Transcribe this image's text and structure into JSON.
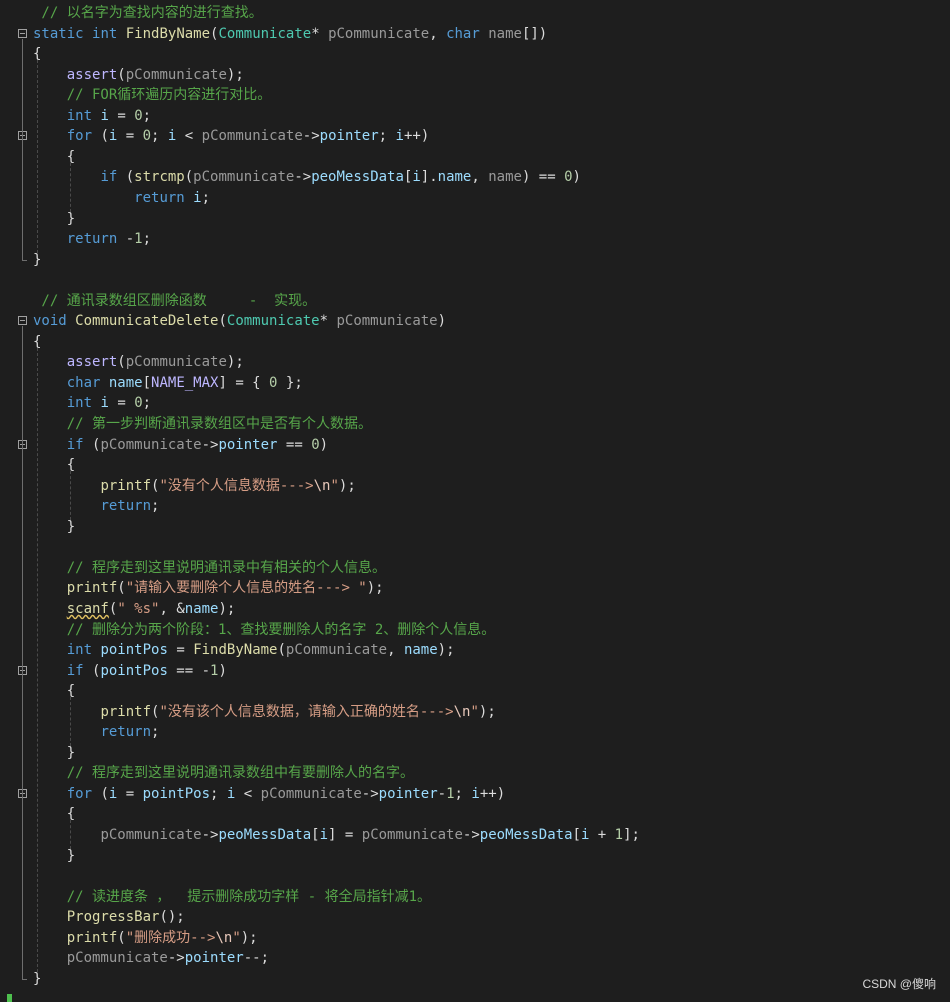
{
  "editor": {
    "lines": [
      [
        [
          "t-cmt",
          " // 以名字为查找内容的进行查找。"
        ]
      ],
      [
        [
          "t-kw",
          "static"
        ],
        [
          "t-pu",
          " "
        ],
        [
          "t-kw",
          "int"
        ],
        [
          "t-pu",
          " "
        ],
        [
          "t-fn",
          "FindByName"
        ],
        [
          "t-pu",
          "("
        ],
        [
          "t-ty",
          "Communicate"
        ],
        [
          "t-pu",
          "* "
        ],
        [
          "t-pa",
          "pCommunicate"
        ],
        [
          "t-pu",
          ", "
        ],
        [
          "t-kw",
          "char"
        ],
        [
          "t-pu",
          " "
        ],
        [
          "t-pa",
          "name"
        ],
        [
          "t-pu",
          "[])"
        ]
      ],
      [
        [
          "t-pu",
          "{"
        ]
      ],
      [
        [
          "t-pu",
          "    "
        ],
        [
          "t-mc",
          "assert"
        ],
        [
          "t-pu",
          "("
        ],
        [
          "t-pa",
          "pCommunicate"
        ],
        [
          "t-pu",
          ");"
        ]
      ],
      [
        [
          "t-pu",
          "    "
        ],
        [
          "t-cmt",
          "// FOR循环遍历内容进行对比。"
        ]
      ],
      [
        [
          "t-pu",
          "    "
        ],
        [
          "t-kw",
          "int"
        ],
        [
          "t-pu",
          " "
        ],
        [
          "t-lv",
          "i"
        ],
        [
          "t-pu",
          " = "
        ],
        [
          "t-nu",
          "0"
        ],
        [
          "t-pu",
          ";"
        ]
      ],
      [
        [
          "t-pu",
          "    "
        ],
        [
          "t-kw",
          "for"
        ],
        [
          "t-pu",
          " ("
        ],
        [
          "t-lv",
          "i"
        ],
        [
          "t-pu",
          " = "
        ],
        [
          "t-nu",
          "0"
        ],
        [
          "t-pu",
          "; "
        ],
        [
          "t-lv",
          "i"
        ],
        [
          "t-pu",
          " < "
        ],
        [
          "t-pa",
          "pCommunicate"
        ],
        [
          "t-pu",
          "->"
        ],
        [
          "t-lv",
          "pointer"
        ],
        [
          "t-pu",
          "; "
        ],
        [
          "t-lv",
          "i"
        ],
        [
          "t-pu",
          "++)"
        ]
      ],
      [
        [
          "t-pu",
          "    {"
        ]
      ],
      [
        [
          "t-pu",
          "        "
        ],
        [
          "t-kw",
          "if"
        ],
        [
          "t-pu",
          " ("
        ],
        [
          "t-fn",
          "strcmp"
        ],
        [
          "t-pu",
          "("
        ],
        [
          "t-pa",
          "pCommunicate"
        ],
        [
          "t-pu",
          "->"
        ],
        [
          "t-lv",
          "peoMessData"
        ],
        [
          "t-pu",
          "["
        ],
        [
          "t-lv",
          "i"
        ],
        [
          "t-pu",
          "]."
        ],
        [
          "t-lv",
          "name"
        ],
        [
          "t-pu",
          ", "
        ],
        [
          "t-pa",
          "name"
        ],
        [
          "t-pu",
          ") == "
        ],
        [
          "t-nu",
          "0"
        ],
        [
          "t-pu",
          ")"
        ]
      ],
      [
        [
          "t-pu",
          "            "
        ],
        [
          "t-kw",
          "return"
        ],
        [
          "t-pu",
          " "
        ],
        [
          "t-lv",
          "i"
        ],
        [
          "t-pu",
          ";"
        ]
      ],
      [
        [
          "t-pu",
          "    }"
        ]
      ],
      [
        [
          "t-pu",
          "    "
        ],
        [
          "t-kw",
          "return"
        ],
        [
          "t-pu",
          " -"
        ],
        [
          "t-nu",
          "1"
        ],
        [
          "t-pu",
          ";"
        ]
      ],
      [
        [
          "t-pu",
          "}"
        ]
      ],
      [],
      [
        [
          "t-cmt",
          " // 通讯录数组区删除函数     -  实现。"
        ]
      ],
      [
        [
          "t-kw",
          "void"
        ],
        [
          "t-pu",
          " "
        ],
        [
          "t-fn",
          "CommunicateDelete"
        ],
        [
          "t-pu",
          "("
        ],
        [
          "t-ty",
          "Communicate"
        ],
        [
          "t-pu",
          "* "
        ],
        [
          "t-pa",
          "pCommunicate"
        ],
        [
          "t-pu",
          ")"
        ]
      ],
      [
        [
          "t-pu",
          "{"
        ]
      ],
      [
        [
          "t-pu",
          "    "
        ],
        [
          "t-mc",
          "assert"
        ],
        [
          "t-pu",
          "("
        ],
        [
          "t-pa",
          "pCommunicate"
        ],
        [
          "t-pu",
          ");"
        ]
      ],
      [
        [
          "t-pu",
          "    "
        ],
        [
          "t-kw",
          "char"
        ],
        [
          "t-pu",
          " "
        ],
        [
          "t-lv",
          "name"
        ],
        [
          "t-pu",
          "["
        ],
        [
          "t-mc",
          "NAME_MAX"
        ],
        [
          "t-pu",
          "] = { "
        ],
        [
          "t-nu",
          "0"
        ],
        [
          "t-pu",
          " };"
        ]
      ],
      [
        [
          "t-pu",
          "    "
        ],
        [
          "t-kw",
          "int"
        ],
        [
          "t-pu",
          " "
        ],
        [
          "t-lv",
          "i"
        ],
        [
          "t-pu",
          " = "
        ],
        [
          "t-nu",
          "0"
        ],
        [
          "t-pu",
          ";"
        ]
      ],
      [
        [
          "t-pu",
          "    "
        ],
        [
          "t-cmt",
          "// 第一步判断通讯录数组区中是否有个人数据。"
        ]
      ],
      [
        [
          "t-pu",
          "    "
        ],
        [
          "t-kw",
          "if"
        ],
        [
          "t-pu",
          " ("
        ],
        [
          "t-pa",
          "pCommunicate"
        ],
        [
          "t-pu",
          "->"
        ],
        [
          "t-lv",
          "pointer"
        ],
        [
          "t-pu",
          " == "
        ],
        [
          "t-nu",
          "0"
        ],
        [
          "t-pu",
          ")"
        ]
      ],
      [
        [
          "t-pu",
          "    {"
        ]
      ],
      [
        [
          "t-pu",
          "        "
        ],
        [
          "t-fn",
          "printf"
        ],
        [
          "t-pu",
          "("
        ],
        [
          "t-st",
          "\"没有个人信息数据--->"
        ],
        [
          "t-esc",
          "\\n"
        ],
        [
          "t-st",
          "\""
        ],
        [
          "t-pu",
          ");"
        ]
      ],
      [
        [
          "t-pu",
          "        "
        ],
        [
          "t-kw",
          "return"
        ],
        [
          "t-pu",
          ";"
        ]
      ],
      [
        [
          "t-pu",
          "    }"
        ]
      ],
      [],
      [
        [
          "t-pu",
          "    "
        ],
        [
          "t-cmt",
          "// 程序走到这里说明通讯录中有相关的个人信息。"
        ]
      ],
      [
        [
          "t-pu",
          "    "
        ],
        [
          "t-fn",
          "printf"
        ],
        [
          "t-pu",
          "("
        ],
        [
          "t-st",
          "\"请输入要删除个人信息的姓名---> \""
        ],
        [
          "t-pu",
          ");"
        ]
      ],
      [
        [
          "t-pu",
          "    "
        ],
        [
          "t-fn t-wv",
          "scanf"
        ],
        [
          "t-pu",
          "("
        ],
        [
          "t-st",
          "\" %s\""
        ],
        [
          "t-pu",
          ", &"
        ],
        [
          "t-lv",
          "name"
        ],
        [
          "t-pu",
          ");"
        ]
      ],
      [
        [
          "t-pu",
          "    "
        ],
        [
          "t-cmt",
          "// 删除分为两个阶段：1、查找要删除人的名字 2、删除个人信息。"
        ]
      ],
      [
        [
          "t-pu",
          "    "
        ],
        [
          "t-kw",
          "int"
        ],
        [
          "t-pu",
          " "
        ],
        [
          "t-lv",
          "pointPos"
        ],
        [
          "t-pu",
          " = "
        ],
        [
          "t-fn",
          "FindByName"
        ],
        [
          "t-pu",
          "("
        ],
        [
          "t-pa",
          "pCommunicate"
        ],
        [
          "t-pu",
          ", "
        ],
        [
          "t-lv",
          "name"
        ],
        [
          "t-pu",
          ");"
        ]
      ],
      [
        [
          "t-pu",
          "    "
        ],
        [
          "t-kw",
          "if"
        ],
        [
          "t-pu",
          " ("
        ],
        [
          "t-lv",
          "pointPos"
        ],
        [
          "t-pu",
          " == -"
        ],
        [
          "t-nu",
          "1"
        ],
        [
          "t-pu",
          ")"
        ]
      ],
      [
        [
          "t-pu",
          "    {"
        ]
      ],
      [
        [
          "t-pu",
          "        "
        ],
        [
          "t-fn",
          "printf"
        ],
        [
          "t-pu",
          "("
        ],
        [
          "t-st",
          "\"没有该个人信息数据，请输入正确的姓名--->"
        ],
        [
          "t-esc",
          "\\n"
        ],
        [
          "t-st",
          "\""
        ],
        [
          "t-pu",
          ");"
        ]
      ],
      [
        [
          "t-pu",
          "        "
        ],
        [
          "t-kw",
          "return"
        ],
        [
          "t-pu",
          ";"
        ]
      ],
      [
        [
          "t-pu",
          "    }"
        ]
      ],
      [
        [
          "t-pu",
          "    "
        ],
        [
          "t-cmt",
          "// 程序走到这里说明通讯录数组中有要删除人的名字。"
        ]
      ],
      [
        [
          "t-pu",
          "    "
        ],
        [
          "t-kw",
          "for"
        ],
        [
          "t-pu",
          " ("
        ],
        [
          "t-lv",
          "i"
        ],
        [
          "t-pu",
          " = "
        ],
        [
          "t-lv",
          "pointPos"
        ],
        [
          "t-pu",
          "; "
        ],
        [
          "t-lv",
          "i"
        ],
        [
          "t-pu",
          " < "
        ],
        [
          "t-pa",
          "pCommunicate"
        ],
        [
          "t-pu",
          "->"
        ],
        [
          "t-lv",
          "pointer"
        ],
        [
          "t-pu",
          "-"
        ],
        [
          "t-nu",
          "1"
        ],
        [
          "t-pu",
          "; "
        ],
        [
          "t-lv",
          "i"
        ],
        [
          "t-pu",
          "++)"
        ]
      ],
      [
        [
          "t-pu",
          "    {"
        ]
      ],
      [
        [
          "t-pu",
          "        "
        ],
        [
          "t-pa",
          "pCommunicate"
        ],
        [
          "t-pu",
          "->"
        ],
        [
          "t-lv",
          "peoMessData"
        ],
        [
          "t-pu",
          "["
        ],
        [
          "t-lv",
          "i"
        ],
        [
          "t-pu",
          "] = "
        ],
        [
          "t-pa",
          "pCommunicate"
        ],
        [
          "t-pu",
          "->"
        ],
        [
          "t-lv",
          "peoMessData"
        ],
        [
          "t-pu",
          "["
        ],
        [
          "t-lv",
          "i"
        ],
        [
          "t-pu",
          " + "
        ],
        [
          "t-nu",
          "1"
        ],
        [
          "t-pu",
          "];"
        ]
      ],
      [
        [
          "t-pu",
          "    }"
        ]
      ],
      [],
      [
        [
          "t-pu",
          "    "
        ],
        [
          "t-cmt",
          "// 读进度条 ，  提示删除成功字样 - 将全局指针减1。"
        ]
      ],
      [
        [
          "t-pu",
          "    "
        ],
        [
          "t-fn",
          "ProgressBar"
        ],
        [
          "t-pu",
          "();"
        ]
      ],
      [
        [
          "t-pu",
          "    "
        ],
        [
          "t-fn",
          "printf"
        ],
        [
          "t-pu",
          "("
        ],
        [
          "t-st",
          "\"删除成功-->"
        ],
        [
          "t-esc",
          "\\n"
        ],
        [
          "t-st",
          "\""
        ],
        [
          "t-pu",
          ");"
        ]
      ],
      [
        [
          "t-pu",
          "    "
        ],
        [
          "t-pa",
          "pCommunicate"
        ],
        [
          "t-pu",
          "->"
        ],
        [
          "t-lv",
          "pointer"
        ],
        [
          "t-pu",
          "--;"
        ]
      ],
      [
        [
          "t-pu",
          "}"
        ]
      ]
    ]
  },
  "watermark": "CSDN @傻响"
}
